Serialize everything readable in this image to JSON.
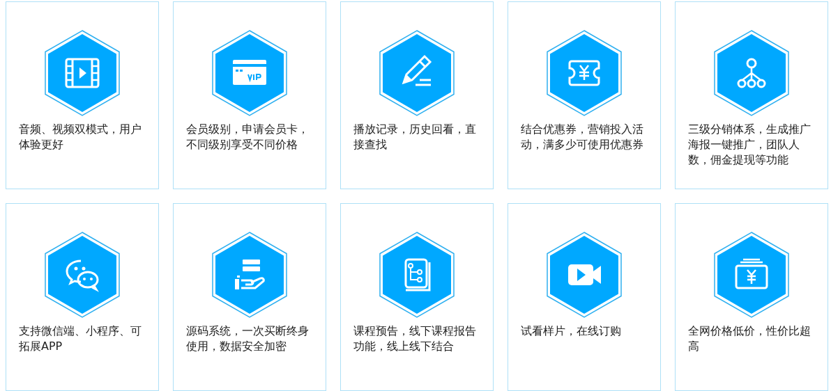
{
  "features": [
    {
      "kind": "film",
      "text": "音频、视频双模式，用户体验更好"
    },
    {
      "kind": "vip",
      "text": "会员级别，申请会员卡，不同级别享受不同价格"
    },
    {
      "kind": "pencil",
      "text": "播放记录，历史回看，直接查找"
    },
    {
      "kind": "ticket",
      "text": "结合优惠券，营销投入活动，满多少可使用优惠券"
    },
    {
      "kind": "tree",
      "text": "三级分销体系，生成推广海报一键推广，团队人数，佣金提现等功能"
    },
    {
      "kind": "chat",
      "text": "支持微信端、小程序、可拓展APP"
    },
    {
      "kind": "server",
      "text": "源码系统，一次买断终身使用，数据安全加密"
    },
    {
      "kind": "book",
      "text": "课程预告，线下课程报告功能，线上线下结合"
    },
    {
      "kind": "camera",
      "text": "试看样片，在线订购"
    },
    {
      "kind": "money",
      "text": "全网价格低价，性价比超高"
    }
  ]
}
